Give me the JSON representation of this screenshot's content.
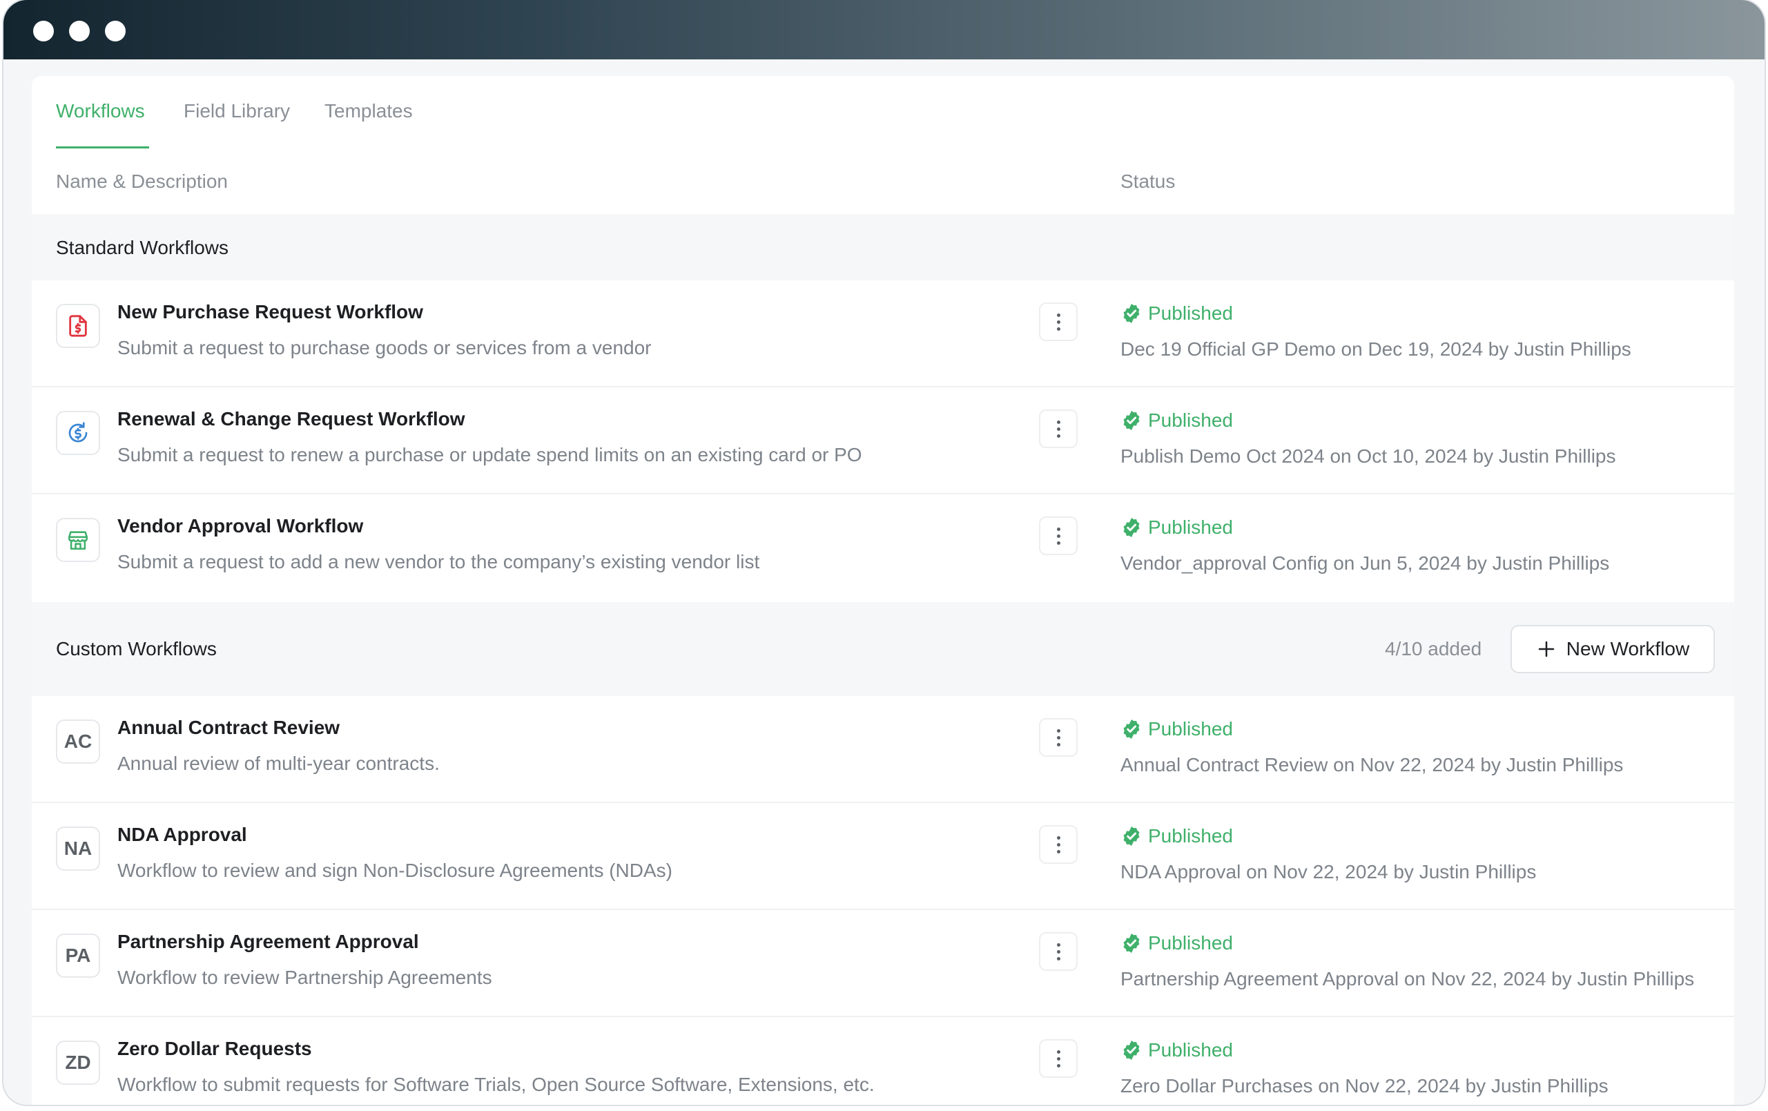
{
  "tabs": [
    {
      "label": "Workflows",
      "active": true
    },
    {
      "label": "Field Library",
      "active": false
    },
    {
      "label": "Templates",
      "active": false
    }
  ],
  "columns": {
    "name": "Name & Description",
    "status": "Status"
  },
  "standard": {
    "title": "Standard Workflows",
    "rows": [
      {
        "icon": "document-dollar-icon",
        "name": "New Purchase Request Workflow",
        "desc": "Submit a request to purchase goods or services from a vendor",
        "status": "Published",
        "detail": "Dec 19 Official GP Demo on Dec 19, 2024 by Justin Phillips"
      },
      {
        "icon": "renewal-dollar-icon",
        "name": "Renewal & Change Request Workflow",
        "desc": "Submit a request to renew a purchase or update spend limits on an existing card or PO",
        "status": "Published",
        "detail": "Publish Demo Oct 2024 on Oct 10, 2024 by Justin Phillips"
      },
      {
        "icon": "storefront-icon",
        "name": "Vendor Approval Workflow",
        "desc": "Submit a request to add a new vendor to the company’s existing vendor list",
        "status": "Published",
        "detail": "Vendor_approval Config on Jun 5, 2024 by Justin Phillips"
      }
    ]
  },
  "custom": {
    "title": "Custom Workflows",
    "count": "4/10 added",
    "new_button": "New Workflow",
    "rows": [
      {
        "initials": "AC",
        "name": "Annual Contract Review",
        "desc": "Annual review of multi-year contracts.",
        "status": "Published",
        "detail": "Annual Contract Review on Nov 22, 2024 by Justin Phillips"
      },
      {
        "initials": "NA",
        "name": "NDA Approval",
        "desc": "Workflow to review and sign Non-Disclosure Agreements (NDAs)",
        "status": "Published",
        "detail": "NDA Approval on Nov 22, 2024 by Justin Phillips"
      },
      {
        "initials": "PA",
        "name": "Partnership Agreement Approval",
        "desc": "Workflow to review Partnership Agreements",
        "status": "Published",
        "detail": "Partnership Agreement Approval on Nov 22, 2024 by Justin Phillips"
      },
      {
        "initials": "ZD",
        "name": "Zero Dollar Requests",
        "desc": "Workflow to submit requests for Software Trials, Open Source Software, Extensions, etc.",
        "status": "Published",
        "detail": "Zero Dollar Purchases on Nov 22, 2024 by Justin Phillips"
      }
    ]
  },
  "colors": {
    "accent": "#3fb06a",
    "danger": "#e0353f",
    "info": "#3a86d4"
  }
}
